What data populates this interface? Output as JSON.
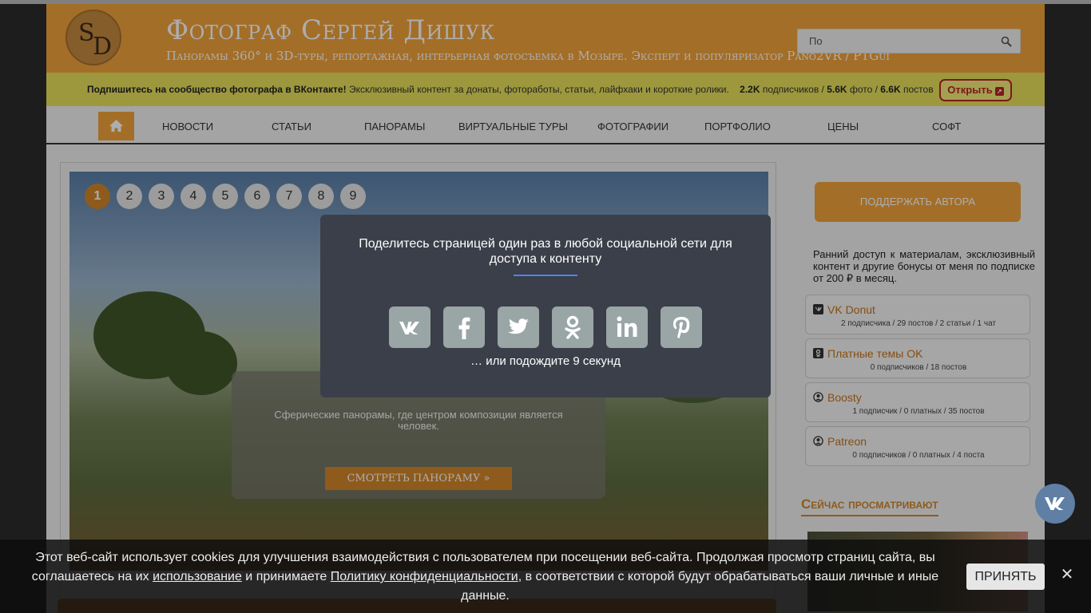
{
  "header": {
    "title": "Фотограф Сергей Дишук",
    "subtitle": "Панорамы 360° и 3D-туры, репортажная, интерьерная фотосъемка в Мозыре. Эксперт и популяризатор Pano2VR / PTGui",
    "logo_s": "S",
    "logo_d": "D",
    "search_placeholder": "По"
  },
  "vk_banner": {
    "lead": "Подпишитесь на сообщество фотографа в ВКонтакте!",
    "text": "Эксклюзивный контент за донаты, фотоработы, статьи, лайфхаки и короткие ролики.",
    "subscribers_count": "2.2K",
    "subscribers_label": "подписчиков /",
    "photos_count": "5.6K",
    "photos_label": "фото /",
    "posts_count": "6.6K",
    "posts_label": "постов",
    "open_label": "Открыть"
  },
  "nav": {
    "items": [
      "Новости",
      "Статьи",
      "Панорамы",
      "Виртуальные туры",
      "Фотографии",
      "Портфолио",
      "Цены",
      "Софт"
    ]
  },
  "slider": {
    "pages": [
      "1",
      "2",
      "3",
      "4",
      "5",
      "6",
      "7",
      "8",
      "9"
    ],
    "active_page": "1",
    "description": "Сферические панорамы, где центром композиции является человек.",
    "button_label": "СМОТРЕТЬ ПАНОРАМУ »"
  },
  "sidebar": {
    "support_label": "Поддержать автора",
    "support_text": "Ранний доступ к материалам, эксклюзивный контент и другие бонусы от меня по подписке от 200 ₽ в месяц.",
    "subscriptions": [
      {
        "name": "VK Donut",
        "stats": "2 подписчика / 29 постов / 2 статьи / 1 чат"
      },
      {
        "name": "Платные темы OK",
        "stats": "0 подписчиков / 18 постов"
      },
      {
        "name": "Boosty",
        "stats": "1 подписчик / 0 платных / 35 постов"
      },
      {
        "name": "Patreon",
        "stats": "0 подписчиков / 0 платных / 4 поста"
      }
    ],
    "now_viewing_title": "Сейчас просматривают"
  },
  "share_modal": {
    "title": "Поделитесь страницей один раз в любой социальной сети для доступа к контенту",
    "networks": [
      "vk-icon",
      "facebook-icon",
      "twitter-icon",
      "odnoklassniki-icon",
      "linkedin-icon",
      "pinterest-icon"
    ],
    "wait_text": "… или подождите 9 секунд"
  },
  "cookie_banner": {
    "text_1": "Этот веб-сайт использует cookies для улучшения взаимодействия с пользователем при посещении веб-сайта. Продолжая просмотр страниц сайта, вы соглашаетесь на их ",
    "link_1": "использование",
    "text_2": " и принимаете ",
    "link_2": "Политику конфиденциальности",
    "text_3": ", в соответствии с которой будут обрабатываться ваши личные и иные данные.",
    "accept_label": "ПРИНЯТЬ",
    "close_label": "✕"
  },
  "colors": {
    "accent": "#f0a23c",
    "accent_dark": "#d1862a",
    "banner_yellow": "#e8e05a",
    "modal_bg": "#3b3f4a",
    "share_button": "#9aa5a6"
  }
}
